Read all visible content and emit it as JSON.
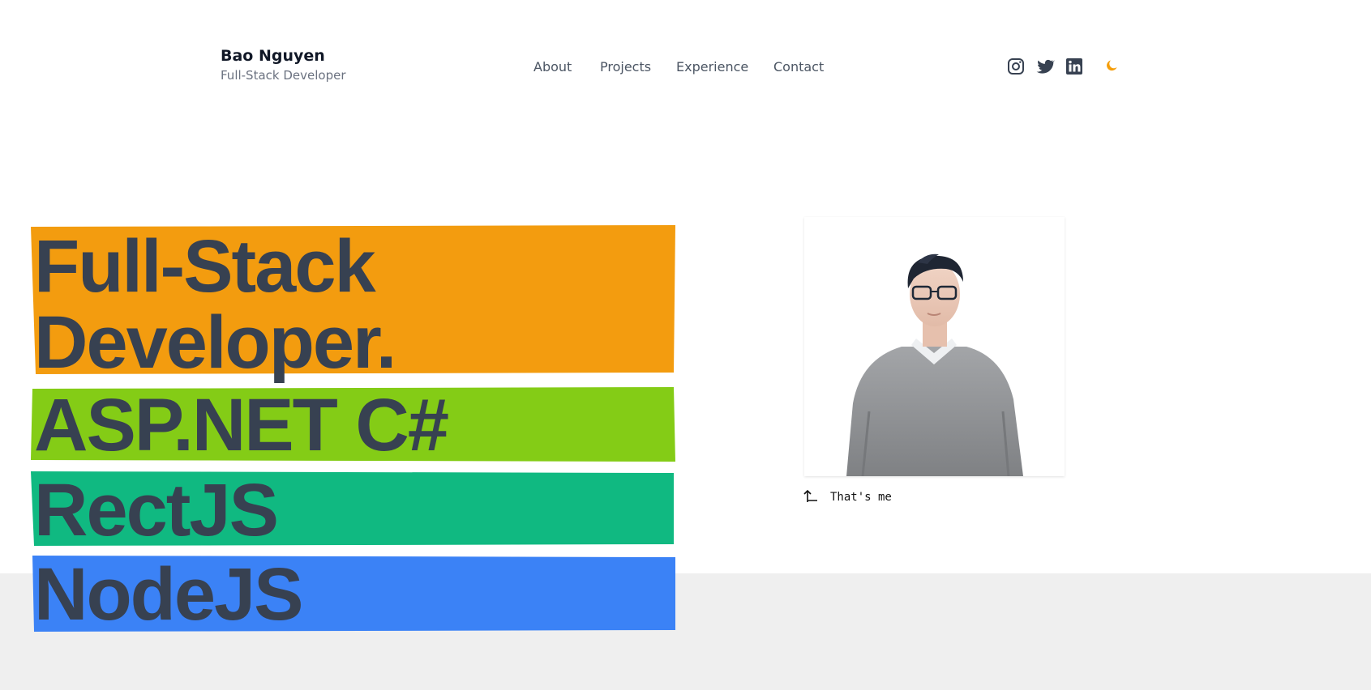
{
  "header": {
    "name": "Bao Nguyen",
    "role": "Full-Stack Developer",
    "nav": [
      "About",
      "Projects",
      "Experience",
      "Contact"
    ],
    "social_icons": [
      "instagram-icon",
      "twitter-icon",
      "linkedin-icon"
    ],
    "theme_toggle_icon": "moon-icon"
  },
  "hero": {
    "lines": [
      "Full-Stack",
      "Developer.",
      "ASP.NET C#",
      "RectJS",
      "NodeJS"
    ],
    "band_colors": [
      "#f39c0f",
      "#84cc16",
      "#10b981",
      "#3b82f6"
    ],
    "text_color": "#374151"
  },
  "avatar": {
    "caption": "That's me",
    "caption_icon": "up-left-arrow-icon"
  },
  "colors": {
    "accent": "#f59e0b",
    "footer_band": "#efefef"
  }
}
